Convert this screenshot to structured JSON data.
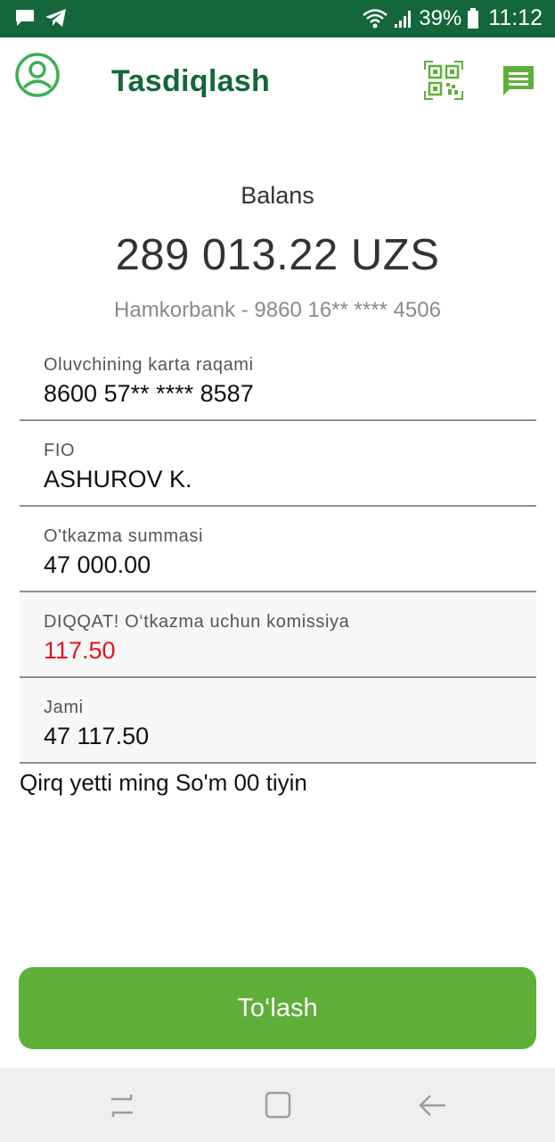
{
  "status_bar": {
    "battery_percent": "39%",
    "time": "11:12",
    "icons": [
      "message-icon",
      "telegram-icon",
      "wifi-icon",
      "signal-icon",
      "battery-icon"
    ]
  },
  "header": {
    "title": "Tasdiqlash",
    "icons": [
      "profile-icon",
      "qr-code-icon",
      "chat-icon"
    ]
  },
  "balance": {
    "label": "Balans",
    "amount": "289 013.22 UZS",
    "card": "Hamkorbank - 9860 16** **** 4506"
  },
  "fields": [
    {
      "label": "Oluvchining karta raqami",
      "value": "8600 57** **** 8587"
    },
    {
      "label": "FIO",
      "value": "ASHUROV K."
    },
    {
      "label": "O'tkazma summasi",
      "value": "47 000.00"
    },
    {
      "label": "DIQQAT! O‘tkazma uchun komissiya",
      "value": "117.50"
    },
    {
      "label": "Jami",
      "value": "47 117.50"
    }
  ],
  "amount_in_words": "Qirq yetti ming So'm 00 tiyin",
  "pay_button": {
    "label": "To‘lash"
  },
  "colors": {
    "primary_dark": "#14673a",
    "accent": "#5faf39",
    "warning": "#e0141b"
  },
  "nav_bar": {
    "icons": [
      "recents-icon",
      "home-icon",
      "back-icon"
    ]
  }
}
